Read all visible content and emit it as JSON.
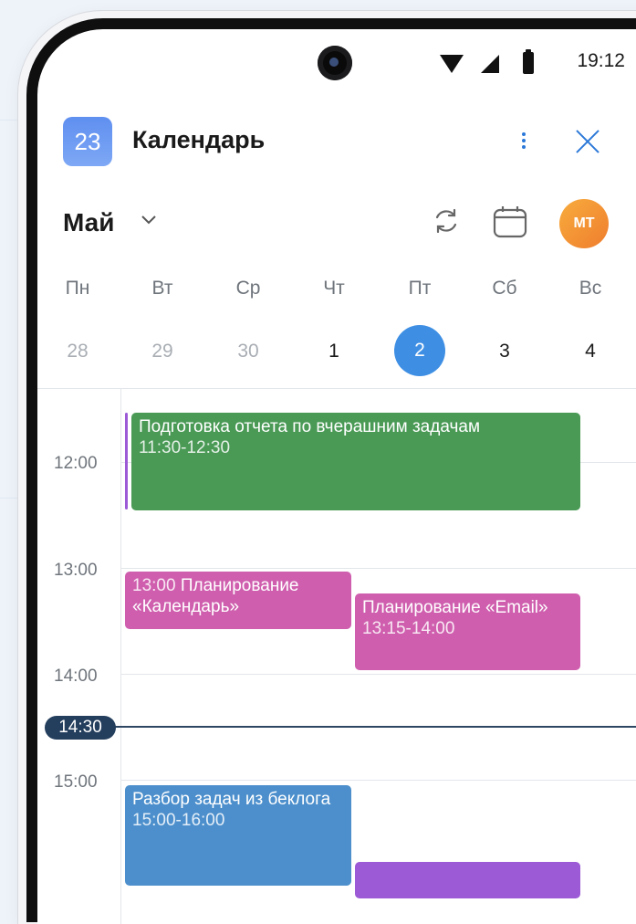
{
  "status_bar": {
    "time": "19:12"
  },
  "app": {
    "icon_day": "23",
    "title": "Календарь"
  },
  "month": {
    "label": "Май"
  },
  "avatar": {
    "initials": "МТ"
  },
  "weekdays": [
    "Пн",
    "Вт",
    "Ср",
    "Чт",
    "Пт",
    "Сб",
    "Вс"
  ],
  "days": [
    "28",
    "29",
    "30",
    "1",
    "2",
    "3",
    "4"
  ],
  "hours": [
    "12:00",
    "13:00",
    "14:00",
    "15:00"
  ],
  "current_time": "14:30",
  "events": [
    {
      "title": "Подготовка отчета по вчерашним задачам",
      "time": "11:30-12:30",
      "color": "#4a9a56"
    },
    {
      "time": "13:00",
      "title": "Планирование «Календарь»",
      "color": "#cf5fae"
    },
    {
      "title": "Планирование «Email»",
      "time": "13:15-14:00",
      "color": "#cf5fae"
    },
    {
      "title": "Разбор задач из беклога",
      "time": "15:00-16:00",
      "color": "#4c8fcc"
    },
    {
      "title": "",
      "color": "#9c5ad6"
    }
  ],
  "icons": [
    "close-icon",
    "more-vertical-icon",
    "sync-icon",
    "calendar-icon",
    "chevron-down-icon",
    "wifi-icon",
    "signal-icon",
    "battery-icon"
  ]
}
